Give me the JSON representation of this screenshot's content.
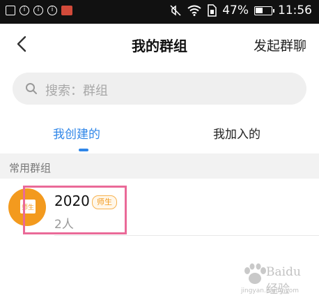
{
  "status_bar": {
    "battery": "47%",
    "time": "11:56",
    "icons": [
      "image-icon",
      "info-icon",
      "info-icon",
      "info-icon",
      "notification-app-icon",
      "mute-icon",
      "wifi-icon",
      "sim-icon",
      "battery-icon"
    ]
  },
  "nav": {
    "title": "我的群组",
    "action": "发起群聊"
  },
  "search": {
    "placeholder": "搜索：群组"
  },
  "tabs": [
    {
      "label": "我创建的",
      "active": true
    },
    {
      "label": "我加入的",
      "active": false
    }
  ],
  "section": {
    "label": "常用群组"
  },
  "groups": [
    {
      "name": "2020",
      "badge": "师生",
      "members": "2人",
      "avatar_label": "师生"
    }
  ],
  "watermark": {
    "brand": "Baidu经验",
    "url": "jingyan.baidu.com"
  },
  "colors": {
    "accent": "#2f86e8",
    "avatar": "#f39a1e",
    "highlight": "#ea6a98"
  }
}
